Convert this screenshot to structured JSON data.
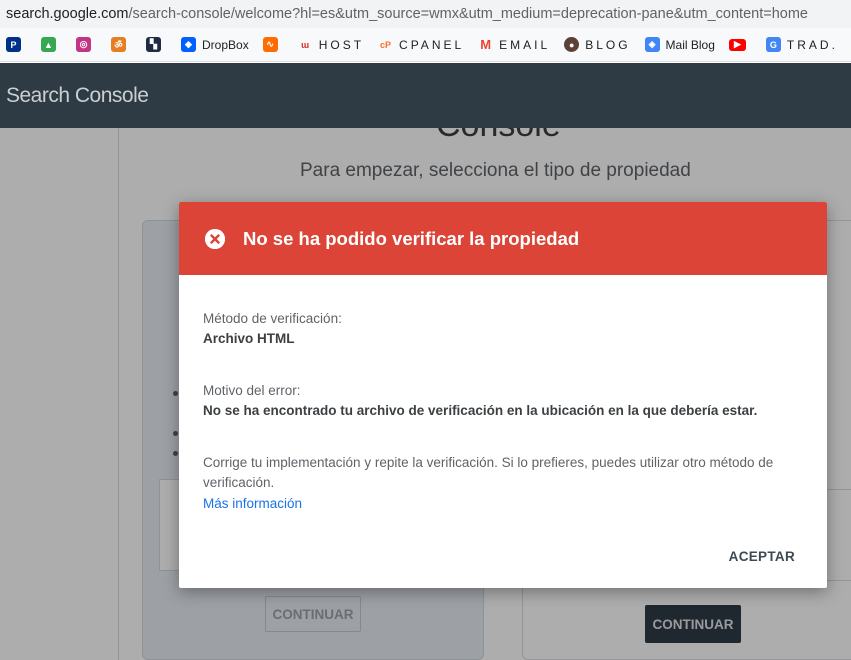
{
  "browser": {
    "url_host": "search.google.com",
    "url_path": "/search-console/welcome?hl=es&utm_source=wmx&utm_medium=deprecation-pane&utm_content=home",
    "bookmarks": [
      {
        "label": "",
        "icon": "paypal-icon",
        "color": "#003087"
      },
      {
        "label": "",
        "icon": "google-drive-icon",
        "color": "#34a853"
      },
      {
        "label": "",
        "icon": "instagram-icon",
        "color": "#c13584"
      },
      {
        "label": "",
        "icon": "om-icon",
        "color": "#e67e22"
      },
      {
        "label": "",
        "icon": "squares-icon",
        "color": "#1f2a44"
      },
      {
        "label": "DropBox",
        "icon": "dropbox-icon",
        "color": "#0061ff"
      },
      {
        "label": "",
        "icon": "wave-icon",
        "color": "#ff6d00"
      },
      {
        "label": "HOST",
        "icon": "host-icon",
        "color": "#d32f2f"
      },
      {
        "label": "CPANEL",
        "icon": "cpanel-icon",
        "color": "#ff6c2c"
      },
      {
        "label": "EMAIL",
        "icon": "gmail-icon",
        "color": "#ea4335"
      },
      {
        "label": "BLOG",
        "icon": "blog-icon",
        "color": "#5d4037"
      },
      {
        "label": "Mail Blog",
        "icon": "mail-blog-icon",
        "color": "#4285f4"
      },
      {
        "label": "",
        "icon": "youtube-icon",
        "color": "#ff0000"
      },
      {
        "label": "TRAD.",
        "icon": "translate-icon",
        "color": "#4285f4"
      }
    ]
  },
  "app": {
    "brand": "Search Console"
  },
  "background": {
    "title": "Console",
    "subtitle": "Para empezar, selecciona el tipo de propiedad",
    "continue_left": "CONTINUAR",
    "continue_right": "CONTINUAR"
  },
  "dialog": {
    "title": "No se ha podido verificar la propiedad",
    "method_label": "Método de verificación:",
    "method_value": "Archivo HTML",
    "reason_label": "Motivo del error:",
    "reason_value": "No se ha encontrado tu archivo de verificación en la ubicación en la que debería estar.",
    "note": "Corrige tu implementación y repite la verificación. Si lo prefieres, puedes utilizar otro método de verificación.",
    "more_link": "Más información",
    "accept": "ACEPTAR",
    "header_color": "#db4437",
    "link_color": "#1a73e8"
  }
}
